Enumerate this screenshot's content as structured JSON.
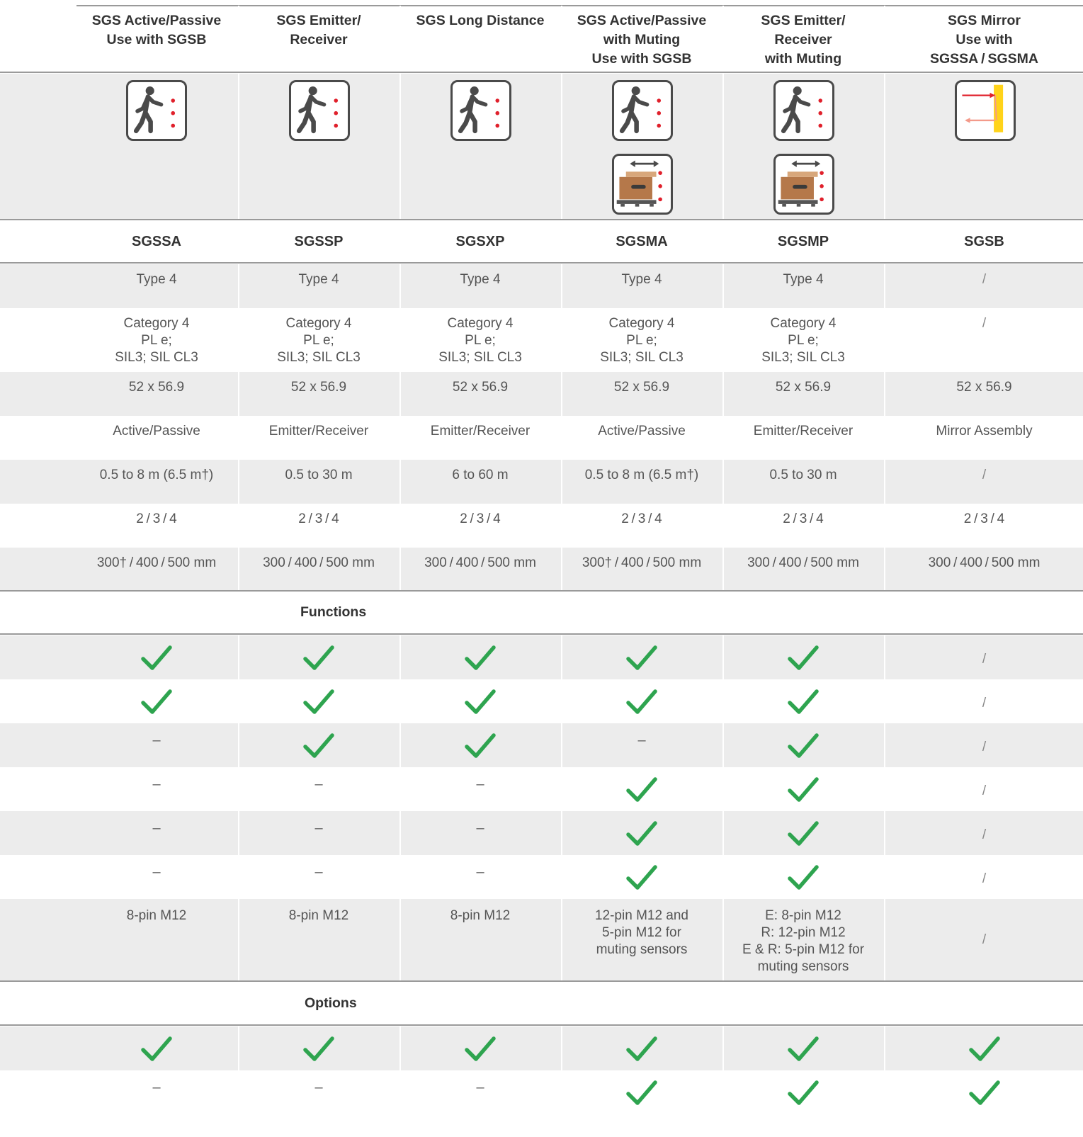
{
  "columns": [
    {
      "header": "SGS Active/Passive\nUse with SGSB",
      "model": "SGSSA"
    },
    {
      "header": "SGS Emitter/\nReceiver",
      "model": "SGSSP"
    },
    {
      "header": "SGS Long Distance",
      "model": "SGSXP"
    },
    {
      "header": "SGS Active/Passive\nwith Muting\nUse with SGSB",
      "model": "SGSMA"
    },
    {
      "header": "SGS Emitter/\nReceiver\nwith Muting",
      "model": "SGSMP"
    },
    {
      "header": "SGS Mirror\nUse with\nSGSSA / SGSMA",
      "model": "SGSB"
    }
  ],
  "icons": [
    [
      "walking-person"
    ],
    [
      "walking-person"
    ],
    [
      "walking-person"
    ],
    [
      "walking-person",
      "box-on-pallet"
    ],
    [
      "walking-person",
      "box-on-pallet"
    ],
    [
      "mirror-reflection"
    ]
  ],
  "spec_rows": [
    [
      "Type 4",
      "Type 4",
      "Type 4",
      "Type 4",
      "Type 4",
      "/"
    ],
    [
      "Category 4\nPL e;\nSIL3; SIL CL3",
      "Category 4\nPL e;\nSIL3; SIL CL3",
      "Category 4\nPL e;\nSIL3; SIL CL3",
      "Category 4\nPL e;\nSIL3; SIL CL3",
      "Category 4\nPL e;\nSIL3; SIL CL3",
      "/"
    ],
    [
      "52 x 56.9",
      "52 x 56.9",
      "52 x 56.9",
      "52 x 56.9",
      "52 x 56.9",
      "52 x 56.9"
    ],
    [
      "Active/Passive",
      "Emitter/Receiver",
      "Emitter/Receiver",
      "Active/Passive",
      "Emitter/Receiver",
      "Mirror Assembly"
    ],
    [
      "0.5 to 8 m (6.5 m†)",
      "0.5 to 30 m",
      "6 to 60 m",
      "0.5 to 8 m (6.5 m†)",
      "0.5 to 30 m",
      "/"
    ],
    [
      "2 / 3 / 4",
      "2 / 3 / 4",
      "2 / 3 / 4",
      "2 / 3 / 4",
      "2 / 3 / 4",
      "2 / 3 / 4"
    ],
    [
      "300† / 400 / 500 mm",
      "300 / 400 / 500 mm",
      "300 / 400 / 500 mm",
      "300† / 400 / 500 mm",
      "300 / 400 / 500 mm",
      "300 / 400 / 500 mm"
    ]
  ],
  "functions": {
    "title": "Functions",
    "rows": [
      [
        "check",
        "check",
        "check",
        "check",
        "check",
        "/"
      ],
      [
        "check",
        "check",
        "check",
        "check",
        "check",
        "/"
      ],
      [
        "–",
        "check",
        "check",
        "–",
        "check",
        "/"
      ],
      [
        "–",
        "–",
        "–",
        "check",
        "check",
        "/"
      ],
      [
        "–",
        "–",
        "–",
        "check",
        "check",
        "/"
      ],
      [
        "–",
        "–",
        "–",
        "check",
        "check",
        "/"
      ],
      [
        "8-pin M12",
        "8-pin M12",
        "8-pin M12",
        "12-pin M12 and\n5-pin M12 for\nmuting sensors",
        "E: 8-pin M12\nR: 12-pin M12\nE & R: 5-pin M12 for\nmuting sensors",
        "/"
      ]
    ]
  },
  "options": {
    "title": "Options",
    "rows": [
      [
        "check",
        "check",
        "check",
        "check",
        "check",
        "check"
      ],
      [
        "–",
        "–",
        "–",
        "check",
        "check",
        "check"
      ]
    ]
  },
  "colors": {
    "check": "#2ea44f",
    "shade": "#ececec",
    "rule": "#9a9a9a",
    "red_dot": "#e0202b",
    "mirror_yellow": "#ffd31a",
    "box_brown": "#b5784a"
  }
}
